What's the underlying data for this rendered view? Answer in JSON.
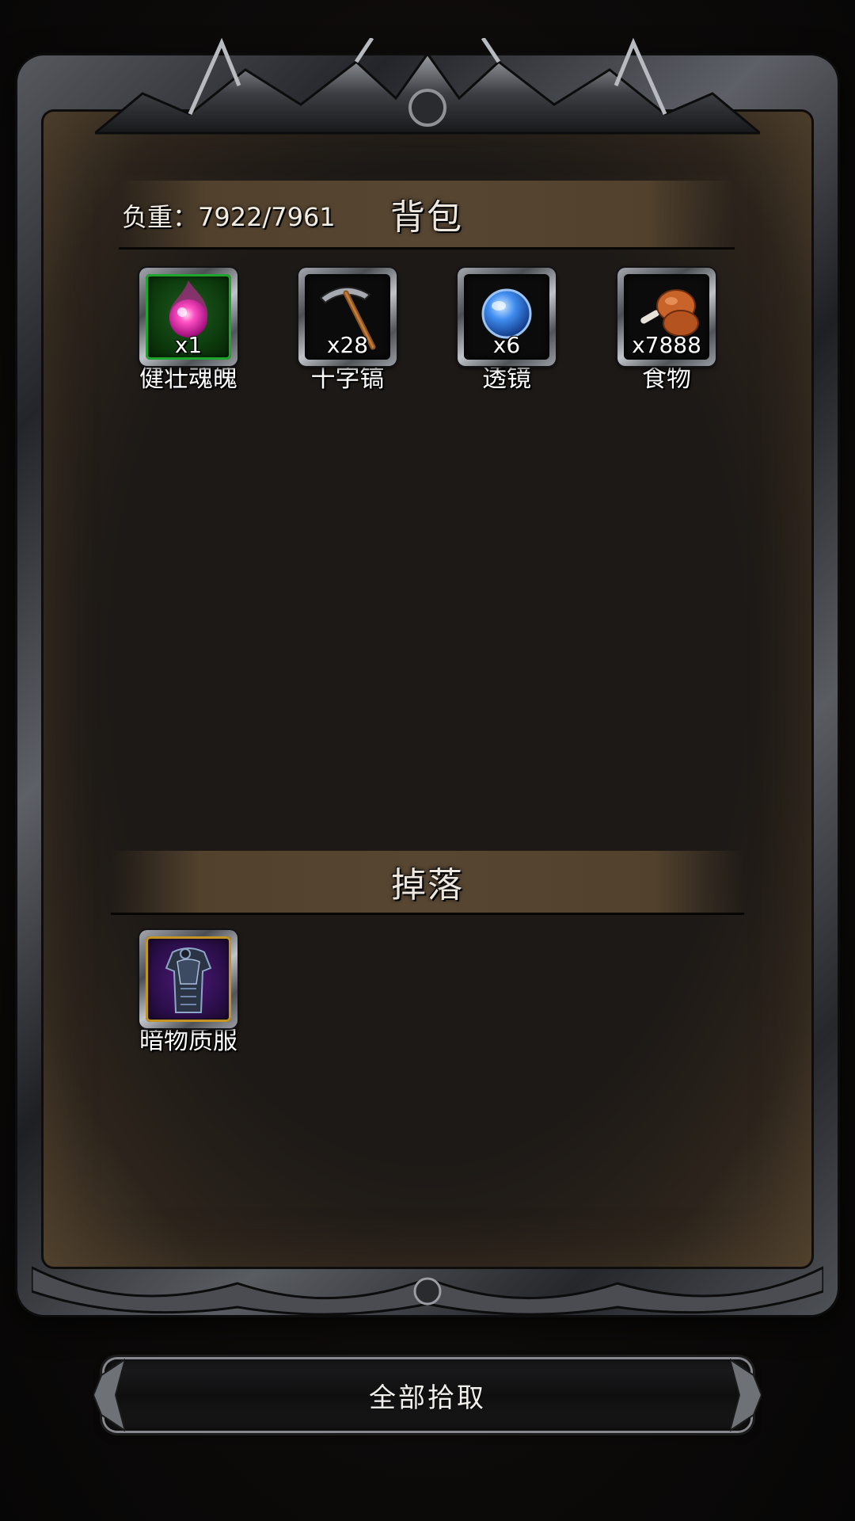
{
  "bag": {
    "title": "背包",
    "capacity_label": "负重：7922/7961",
    "items": [
      {
        "name": "健壮魂魄",
        "qty": "x1",
        "icon": "soul-orb-icon",
        "rarity_color": "#1fa52b"
      },
      {
        "name": "十字镐",
        "qty": "x28",
        "icon": "pickaxe-icon",
        "rarity_color": "#8d9096"
      },
      {
        "name": "透镜",
        "qty": "x6",
        "icon": "lens-icon",
        "rarity_color": "#8d9096"
      },
      {
        "name": "食物",
        "qty": "x7888",
        "icon": "meat-drumstick-icon",
        "rarity_color": "#8d9096"
      }
    ]
  },
  "drop": {
    "title": "掉落",
    "items": [
      {
        "name": "暗物质服",
        "icon": "dark-armor-icon",
        "rarity_color": "#c2961f"
      }
    ]
  },
  "actions": {
    "pickup_all": "全部拾取"
  }
}
